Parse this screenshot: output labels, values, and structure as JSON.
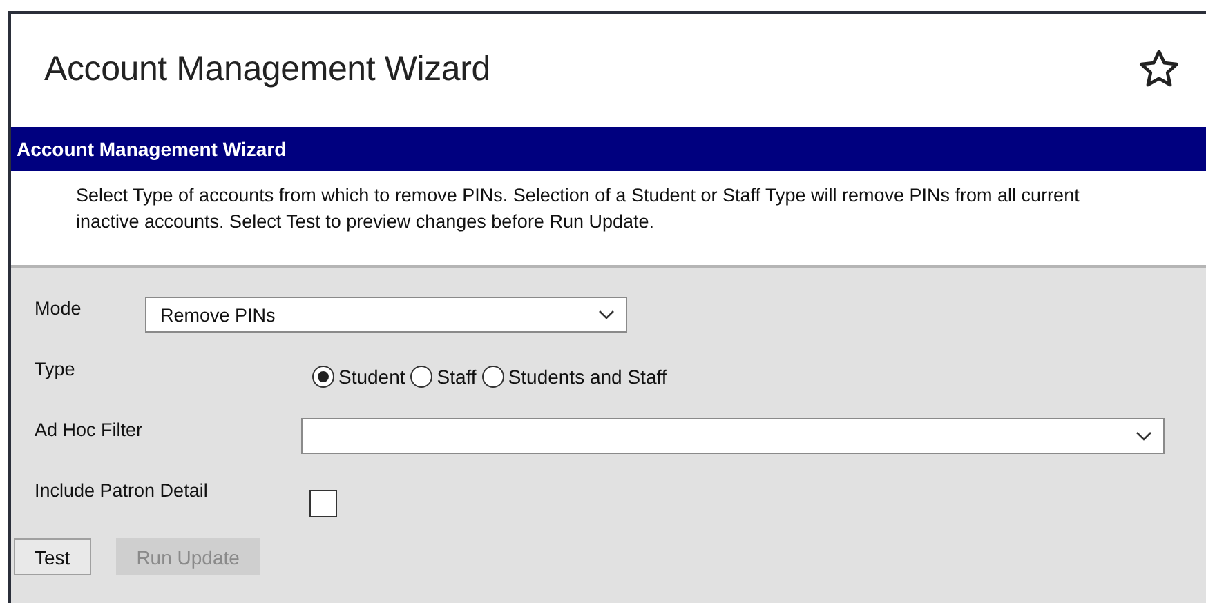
{
  "page": {
    "title": "Account Management Wizard",
    "favorite": false
  },
  "panel": {
    "title": "Account Management Wizard",
    "description": "Select Type of accounts from which to remove PINs. Selection of a Student or Staff Type will remove PINs from all current inactive accounts. Select Test to preview changes before Run Update."
  },
  "fields": [
    {
      "kind": "dropdown",
      "label": "Mode",
      "value": "Remove PINs"
    },
    {
      "kind": "radio",
      "label": "Type",
      "options": [
        {
          "label": "Student",
          "selected": true
        },
        {
          "label": "Staff",
          "selected": false
        },
        {
          "label": "Students and Staff",
          "selected": false
        }
      ]
    },
    {
      "kind": "dropdown",
      "label": "Ad Hoc Filter"
    },
    {
      "kind": "checkbox",
      "label": "Include Patron Detail",
      "checked": false
    }
  ],
  "buttons": [
    {
      "label": "Test",
      "disabled": false
    },
    {
      "label": "Run Update",
      "disabled": true
    }
  ]
}
